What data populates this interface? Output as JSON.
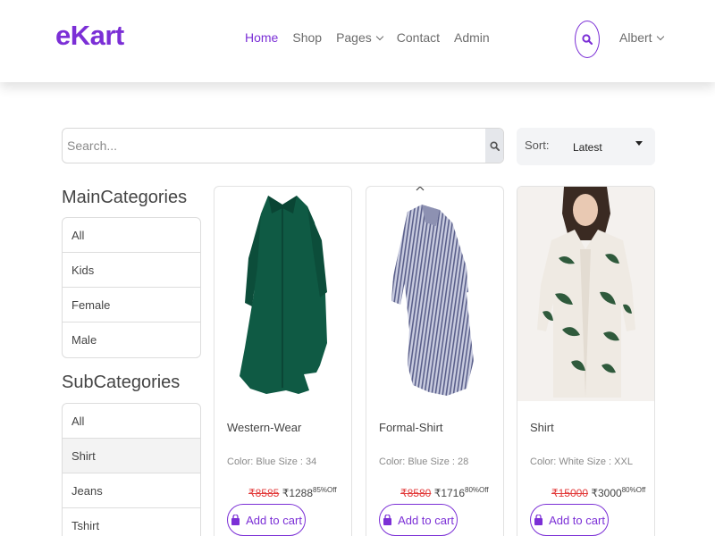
{
  "brand": {
    "logo": "eKart",
    "accent": "#7b2fd6"
  },
  "nav": {
    "items": [
      {
        "label": "Home",
        "active": true
      },
      {
        "label": "Shop",
        "active": false
      },
      {
        "label": "Pages",
        "active": false,
        "dropdown": true
      },
      {
        "label": "Contact",
        "active": false
      },
      {
        "label": "Admin",
        "active": false
      }
    ]
  },
  "header": {
    "search_icon": "search-icon",
    "user_label": "Albert"
  },
  "search": {
    "placeholder": "Search..."
  },
  "sort": {
    "label": "Sort:",
    "value": "Latest"
  },
  "sidebar": {
    "main_title": "MainCategories",
    "main_items": [
      "All",
      "Kids",
      "Female",
      "Male"
    ],
    "sub_title": "SubCategories",
    "sub_items": [
      "All",
      "Shirt",
      "Jeans",
      "Tshirt"
    ],
    "sub_selected": "Shirt"
  },
  "products": [
    {
      "title": "Western-Wear",
      "meta": "Color: Blue Size : 34",
      "old_price": "₹8585",
      "price": "₹1288",
      "discount": "85%Off",
      "button": "Add to cart",
      "image": "green-shirt-dress"
    },
    {
      "title": "Formal-Shirt",
      "meta": "Color: Blue Size : 28",
      "old_price": "₹8580",
      "price": "₹1716",
      "discount": "80%Off",
      "button": "Add to cart",
      "image": "striped-shirt-dress"
    },
    {
      "title": "Shirt",
      "meta": "Color: White Size : XXL",
      "old_price": "₹15000",
      "price": "₹3000",
      "discount": "80%Off",
      "button": "Add to cart",
      "image": "palm-print-shirt"
    }
  ]
}
